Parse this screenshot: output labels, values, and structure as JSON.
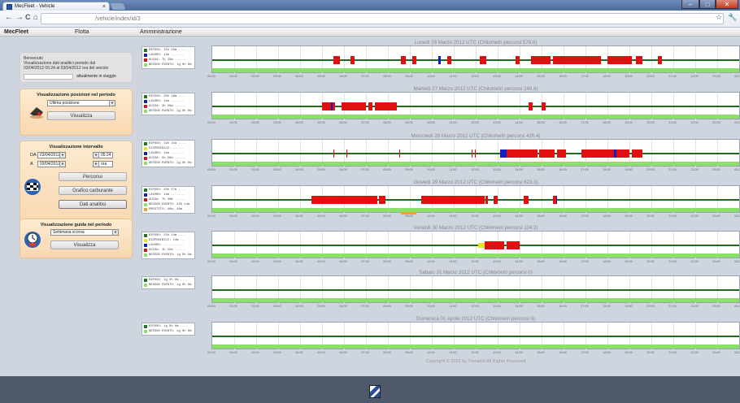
{
  "browser": {
    "tab_title": "MecFleet - Vehicle",
    "tab_close": "×",
    "address": "/vehicle/index/id/3",
    "controls": {
      "back": "←",
      "forward": "→",
      "reload": "C",
      "home": "⌂"
    },
    "window": {
      "minimize": "–",
      "maximize": "□",
      "close": "✕"
    },
    "star": "☆",
    "wrench": "🔧"
  },
  "menu": {
    "brand": "MecFleet",
    "items": [
      "Flotta",
      "Amministrazione"
    ]
  },
  "sidebar": {
    "welcome": {
      "line1": "Benvenuto",
      "line2": "Visualizzazione dati analitici periodo dal",
      "line3": "03/04/2012 05:24 al 03/04/2012 ora del veicolo",
      "status": "attualmente in viaggio"
    },
    "positions": {
      "title": "Visualizzazione posizioni nel periodo",
      "select": "Ultima posizione",
      "button": "Visualizza"
    },
    "interval": {
      "title": "Visualizzazione intervallo",
      "from_label": "DA",
      "from_date": "03/04/2012",
      "from_time": "05:24",
      "to_label": "A",
      "to_date": "03/04/2012",
      "to_time": "ora",
      "buttons": [
        "Percorso",
        "Grafico carburante",
        "Dati analitici"
      ]
    },
    "driving": {
      "title": "Visualizzazione guida nel periodo",
      "select": "Settimana scorsa",
      "button": "Visualizza"
    }
  },
  "colors": {
    "riposo": "#1f7a1f",
    "disponibile": "#f0e020",
    "lavoro": "#1020c8",
    "guida": "#e01010",
    "nessun": "#8be06a",
    "prestito": "#f0a030"
  },
  "hours": [
    "00:00",
    "01:00",
    "02:00",
    "03:00",
    "04:00",
    "05:00",
    "06:00",
    "07:00",
    "08:00",
    "09:00",
    "10:00",
    "11:00",
    "12:00",
    "13:00",
    "14:00",
    "15:00",
    "16:00",
    "17:00",
    "18:00",
    "19:00",
    "20:00",
    "21:00",
    "22:00",
    "23:00",
    "00:00"
  ],
  "chart_data": [
    {
      "type": "timeline",
      "title": "Lunedì 26 Marzo 2012 UTC (Chilometri percorsi 578.6)",
      "legend": [
        "RIPOSO: 15h 55m ....",
        "LAVORO: 12m .......",
        "GUIDA: 7h 49m ......",
        "NESSUN EVENTO: 1g 0h 0m"
      ],
      "legend_colors": [
        "riposo",
        "lavoro",
        "guida",
        "nessun"
      ],
      "segments": [
        [
          5.5,
          5.8,
          "guida"
        ],
        [
          6.3,
          6.5,
          "guida"
        ],
        [
          8.6,
          8.8,
          "guida"
        ],
        [
          9.1,
          9.3,
          "guida"
        ],
        [
          10.3,
          10.4,
          "lavoro"
        ],
        [
          10.7,
          10.9,
          "guida"
        ],
        [
          12.2,
          12.5,
          "guida"
        ],
        [
          13.8,
          14.0,
          "guida"
        ],
        [
          14.5,
          15.4,
          "guida"
        ],
        [
          15.5,
          17.7,
          "guida"
        ],
        [
          18.0,
          19.1,
          "guida"
        ],
        [
          19.3,
          19.6,
          "guida"
        ],
        [
          20.3,
          20.5,
          "guida"
        ]
      ]
    },
    {
      "type": "timeline",
      "title": "Martedì 27 Marzo 2012 UTC (Chilometri percorsi 246.6)",
      "legend": [
        "RIPOSO: 20h 19m ....",
        "LAVORO: 11m .......",
        "GUIDA: 3h 20m ......",
        "NESSUN EVENTO: 1g 0h 0m"
      ],
      "legend_colors": [
        "riposo",
        "lavoro",
        "guida",
        "nessun"
      ],
      "segments": [
        [
          5.0,
          5.6,
          "guida"
        ],
        [
          5.4,
          5.5,
          "lavoro"
        ],
        [
          5.9,
          7.0,
          "guida"
        ],
        [
          7.1,
          7.3,
          "guida"
        ],
        [
          7.4,
          8.4,
          "guida"
        ],
        [
          14.4,
          14.6,
          "guida"
        ],
        [
          15.0,
          15.2,
          "guida"
        ]
      ]
    },
    {
      "type": "timeline",
      "title": "Mercoledì 28 Marzo 2012 UTC (Chilometri percorsi 426.4)",
      "legend": [
        "RIPOSO: 19h 21m ....",
        "DISPONIBILE: ......",
        "LAVORO: 11m .......",
        "GUIDA: 5h 26m ......",
        "NESSUN EVENTO: 1g 0h 0m"
      ],
      "legend_colors": [
        "riposo",
        "disponibile",
        "lavoro",
        "guida",
        "nessun"
      ],
      "segments": [
        [
          5.5,
          5.55,
          "guida"
        ],
        [
          6.1,
          6.15,
          "guida"
        ],
        [
          8.5,
          8.55,
          "guida"
        ],
        [
          11.8,
          11.85,
          "guida"
        ],
        [
          11.95,
          12.0,
          "guida"
        ],
        [
          13.1,
          13.4,
          "lavoro"
        ],
        [
          13.4,
          14.8,
          "guida"
        ],
        [
          14.9,
          15.6,
          "guida"
        ],
        [
          15.7,
          16.1,
          "guida"
        ],
        [
          16.8,
          19.0,
          "guida"
        ],
        [
          18.3,
          18.4,
          "lavoro"
        ],
        [
          19.1,
          19.6,
          "guida"
        ]
      ]
    },
    {
      "type": "timeline",
      "title": "Giovedì 29 Marzo 2012 UTC (Chilometri percorsi 623.3)",
      "legend": [
        "RIPOSO: 10h 57m ....",
        "LAVORO: 12m .......",
        "GUIDA: 7h 30m ......",
        "NESSUN EVENTO: 22h 14m",
        "PRESTITO: 46m, 46m"
      ],
      "legend_colors": [
        "riposo",
        "lavoro",
        "guida",
        "nessun",
        "prestito"
      ],
      "segments": [
        [
          4.5,
          7.5,
          "guida"
        ],
        [
          7.6,
          7.9,
          "guida"
        ],
        [
          9.5,
          12.4,
          "guida"
        ],
        [
          12.45,
          12.55,
          "guida"
        ],
        [
          12.8,
          13.0,
          "guida"
        ],
        [
          14.2,
          14.4,
          "guida"
        ],
        [
          15.5,
          15.7,
          "guida"
        ],
        [
          15.65,
          15.7,
          "lavoro"
        ]
      ],
      "prestito": [
        [
          8.6,
          9.3
        ]
      ]
    },
    {
      "type": "timeline",
      "title": "Venerdì 30 Marzo 2012 UTC (Chilometri percorsi 114.2)",
      "legend": [
        "RIPOSO: 22h 14m ....",
        "DISPONIBILE: 14m ..",
        "LAVORO: ...........",
        "GUIDA: 1h 25m ......",
        "NESSUN EVENTO: 1g 0h 0m"
      ],
      "legend_colors": [
        "riposo",
        "disponibile",
        "lavoro",
        "guida",
        "nessun"
      ],
      "segments": [
        [
          12.1,
          12.4,
          "disponibile"
        ],
        [
          12.4,
          13.3,
          "guida"
        ],
        [
          13.4,
          14.0,
          "guida"
        ]
      ]
    },
    {
      "type": "timeline",
      "title": "Sabato 31 Marzo 2012 UTC (Chilometri percorsi 0)",
      "legend": [
        "RIPOSO: 1g 0h 0m ....",
        "NESSUN EVENTO: 1g 0h 0m"
      ],
      "legend_colors": [
        "riposo",
        "nessun"
      ],
      "segments": []
    },
    {
      "type": "timeline",
      "title": "Domenica 01 Aprile 2012 UTC (Chilometri percorsi 0)",
      "legend": [
        "RIPOSO: 1g 0h 0m ....",
        "NESSUN EVENTO: 1g 0h 0m"
      ],
      "legend_colors": [
        "riposo",
        "nessun"
      ],
      "segments": []
    }
  ],
  "copyright": "Copyright © 2012 by Trenad.it All Rights Reserved"
}
